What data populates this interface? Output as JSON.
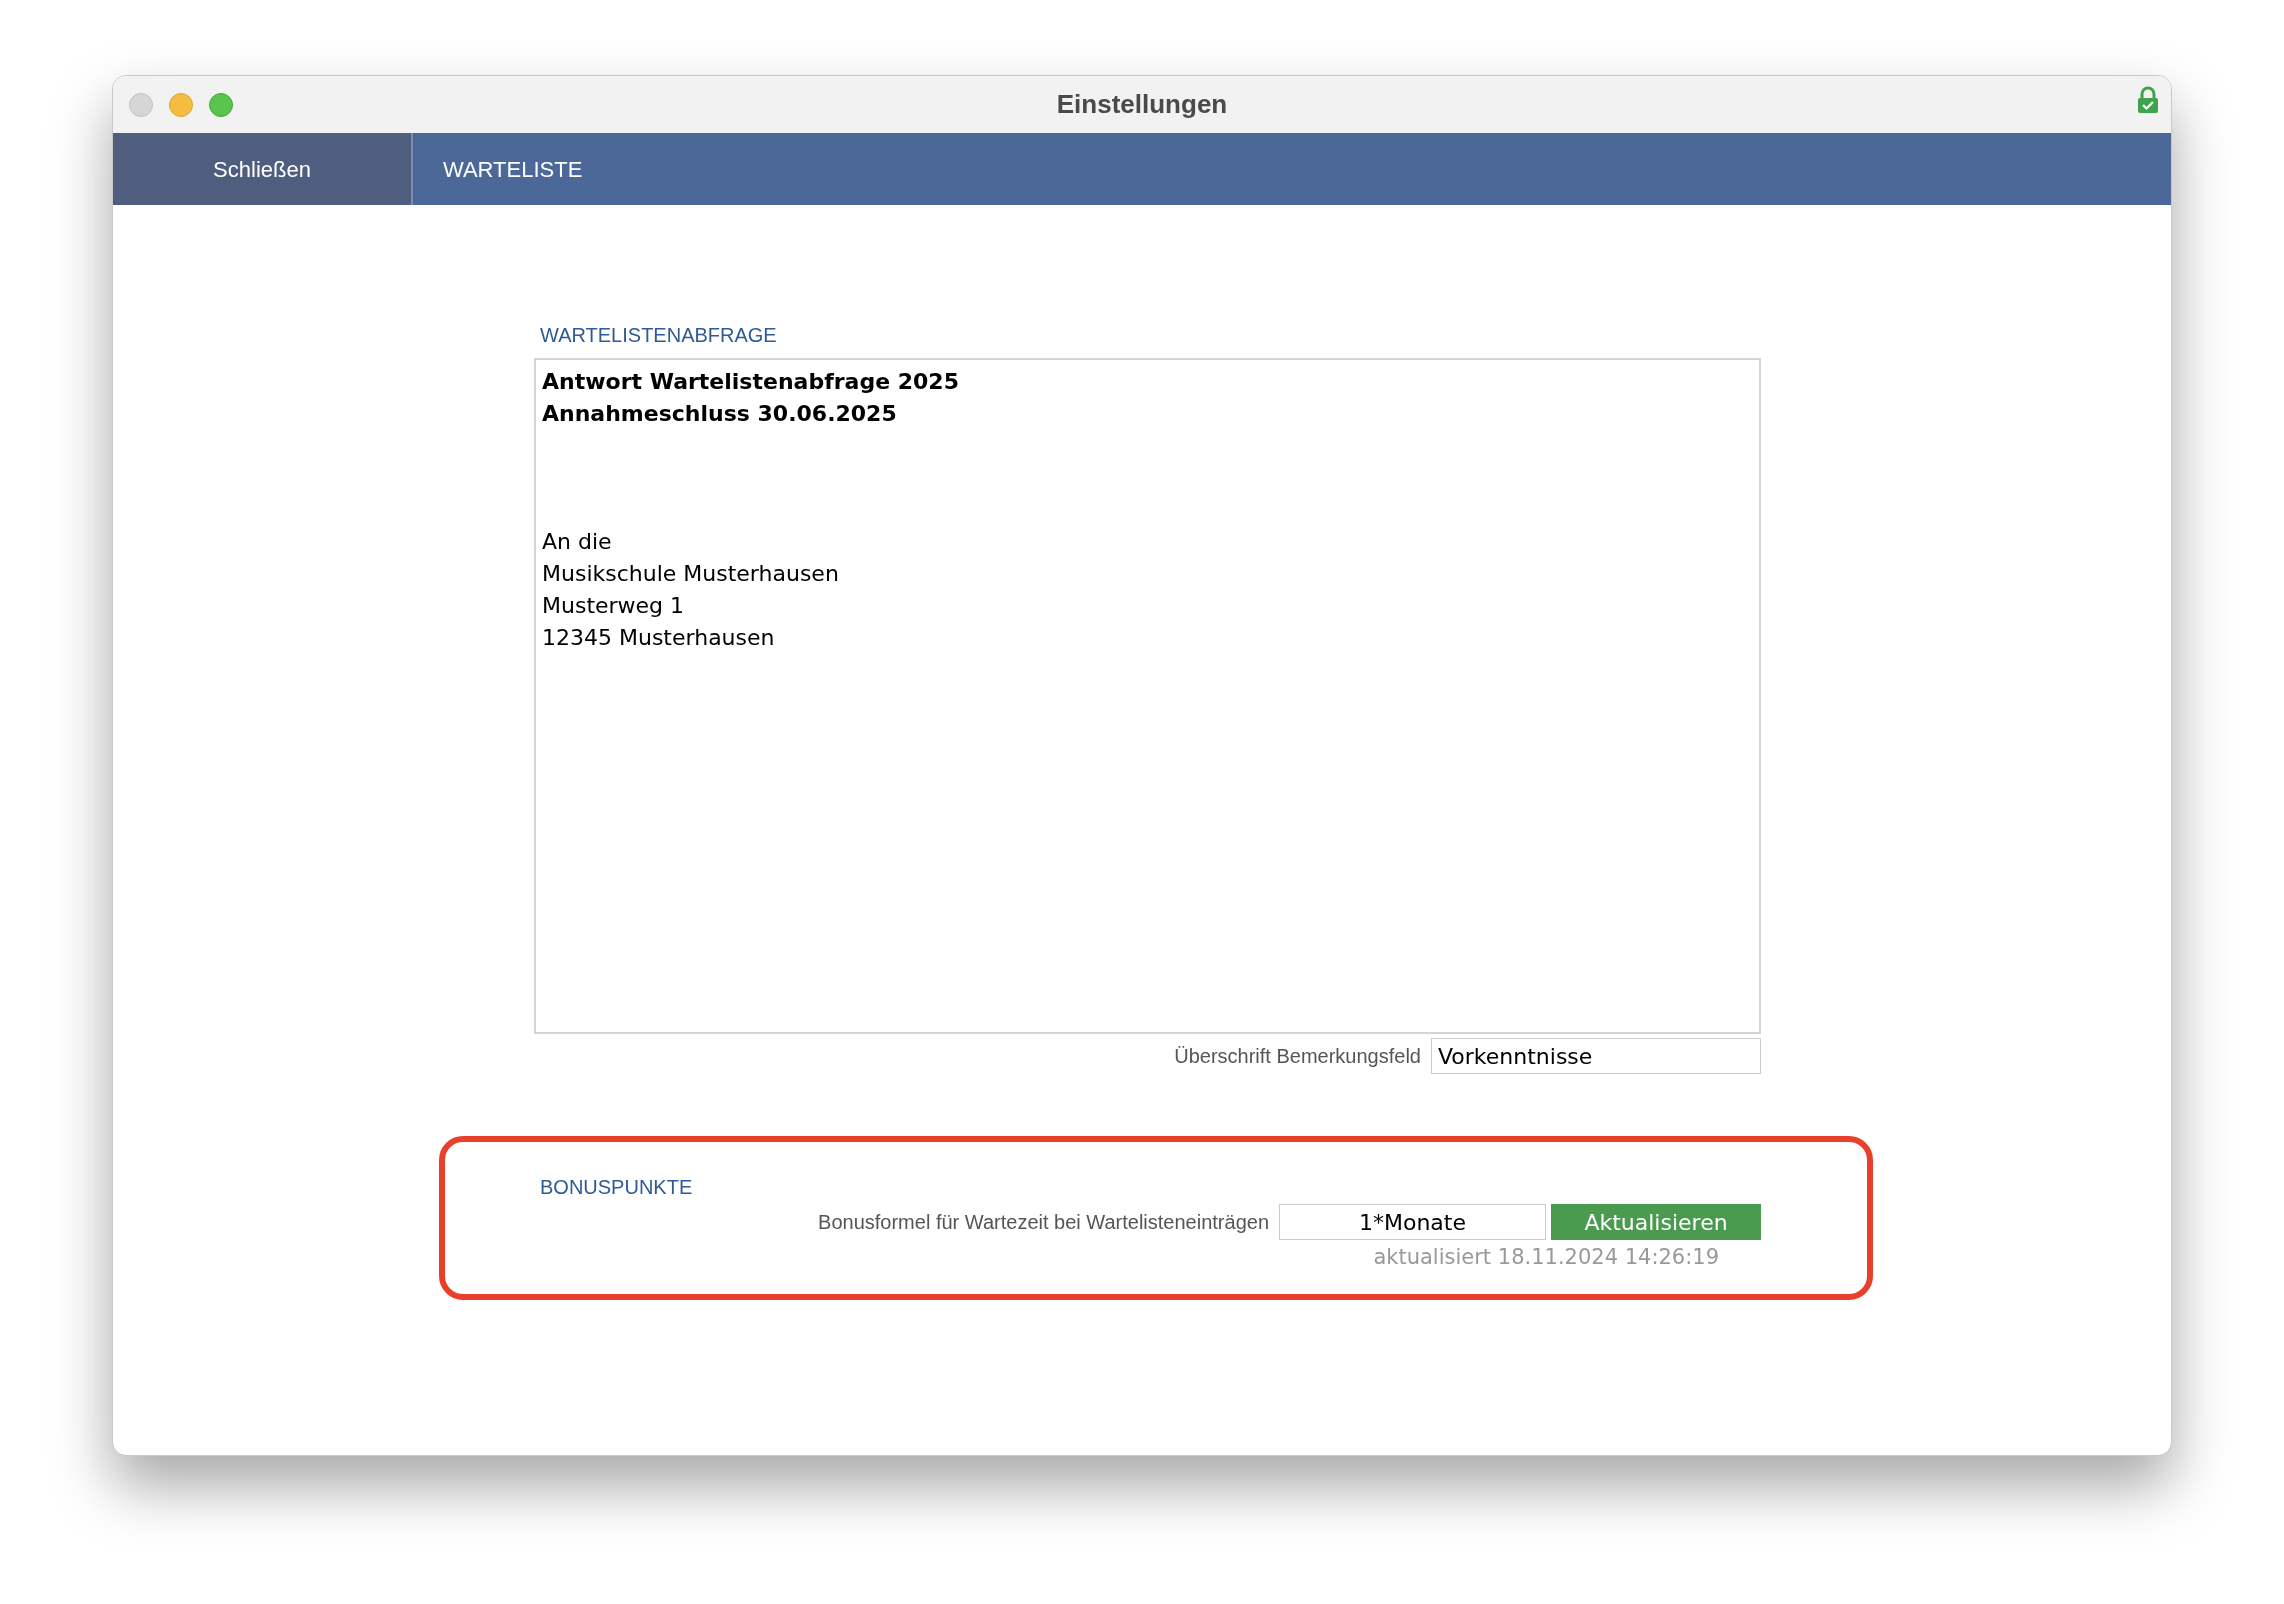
{
  "window": {
    "title": "Einstellungen"
  },
  "nav": {
    "close_button": "Schließen",
    "title": "WARTELISTE"
  },
  "waitlist_query": {
    "heading": "WARTELISTENABFRAGE",
    "paragraphs": [
      {
        "bold": true,
        "lines": [
          "Antwort Wartelistenabfrage 2025",
          "Annahmeschluss 30.06.2025"
        ]
      },
      {
        "bold": false,
        "lines": [
          "An die",
          "Musikschule Musterhausen",
          "Musterweg 1",
          "12345 Musterhausen"
        ]
      }
    ],
    "remark_label": "Überschrift Bemerkungsfeld",
    "remark_value": "Vorkenntnisse"
  },
  "bonus": {
    "heading": "BONUSPUNKTE",
    "formula_label": "Bonusformel für Wartezeit bei Wartelisteneinträgen",
    "formula_value": "1*Monate",
    "update_button": "Aktualisieren",
    "updated_note": "aktualisiert 18.11.2024 14:26:19",
    "highlighted": true
  }
}
